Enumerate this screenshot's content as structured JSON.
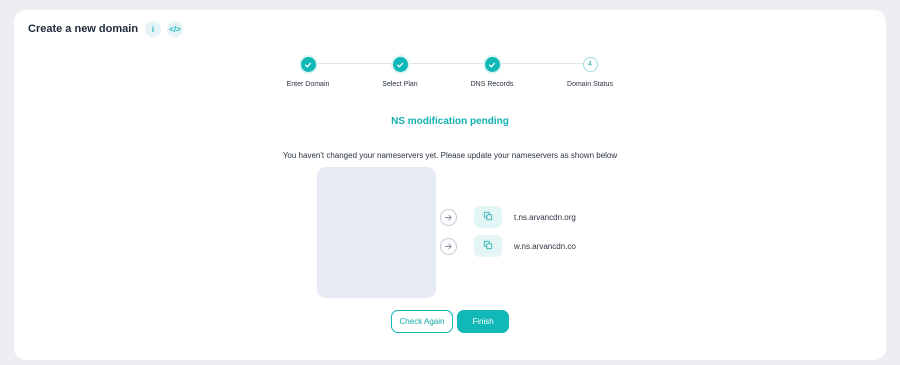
{
  "header": {
    "title": "Create a new domain",
    "info_icon": "i",
    "code_icon": "</>"
  },
  "stepper": {
    "steps": [
      {
        "label": "Enter Domain",
        "state": "done"
      },
      {
        "label": "Select Plan",
        "state": "done"
      },
      {
        "label": "DNS Records",
        "state": "done"
      },
      {
        "label": "Domain Status",
        "state": "pending",
        "number": "4"
      }
    ]
  },
  "status": {
    "title": "NS modification pending",
    "message": "You haven't changed your nameservers yet. Please update your nameservers as shown below"
  },
  "nameservers": [
    {
      "value": "t.ns.arvancdn.org"
    },
    {
      "value": "w.ns.arvancdn.co"
    }
  ],
  "actions": {
    "check_again": "Check Again",
    "finish": "Finish"
  },
  "colors": {
    "accent": "#10b8b8",
    "accent_light": "#e3f5f5",
    "placeholder": "#e6eaf3",
    "background": "#eceef2"
  },
  "icons": {
    "step_done": "check-icon",
    "arrow": "arrow-right-icon",
    "copy": "copy-icon"
  }
}
